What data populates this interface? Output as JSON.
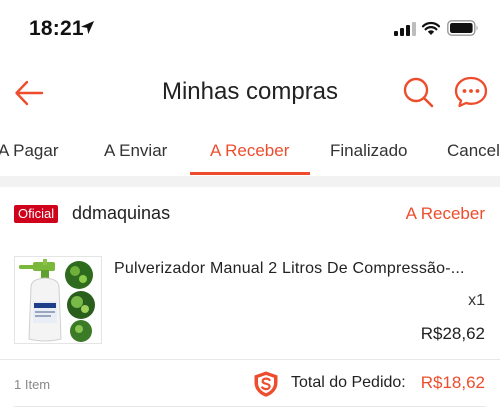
{
  "status_bar": {
    "time": "18:21",
    "icons": [
      "location-arrow-icon",
      "cellular-signal-icon",
      "wifi-icon",
      "battery-icon"
    ]
  },
  "header": {
    "title": "Minhas compras",
    "icons": [
      "back-arrow-icon",
      "search-icon",
      "chat-icon"
    ]
  },
  "tabs": [
    {
      "label": "A Pagar",
      "active": false
    },
    {
      "label": "A Enviar",
      "active": false
    },
    {
      "label": "A Receber",
      "active": true
    },
    {
      "label": "Finalizado",
      "active": false
    },
    {
      "label": "Cancel",
      "active": false
    }
  ],
  "order": {
    "badge": "Oficial",
    "shop_name": "ddmaquinas",
    "status": "A Receber",
    "product": {
      "title": "Pulverizador Manual 2 Litros De Compressão-...",
      "quantity": "x1",
      "price": "R$28,62",
      "image_icon": "sprayer-product-image"
    },
    "item_count": "1 Item",
    "total_label": "Total do Pedido:",
    "total_value": "R$18,62",
    "guarantee_icon": "shield-guarantee-icon"
  },
  "colors": {
    "accent": "#ee4d2d",
    "badge": "#d0011b"
  }
}
